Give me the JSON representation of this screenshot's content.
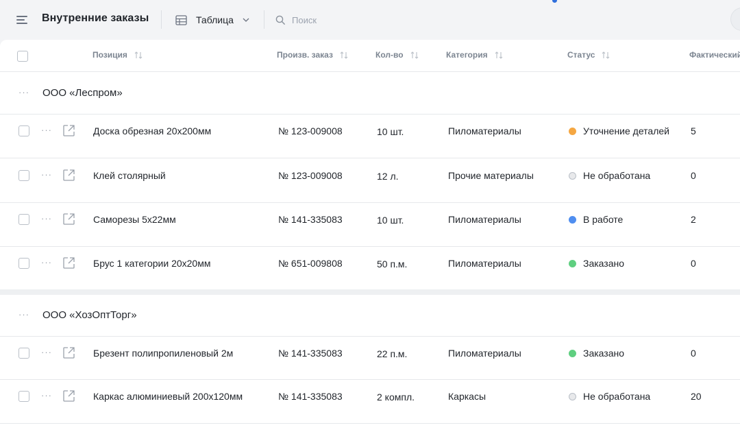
{
  "header": {
    "title": "Внутренние заказы",
    "view_label": "Таблица",
    "search_placeholder": "Поиск"
  },
  "columns": {
    "position": "Позиция",
    "order": "Произв. заказ",
    "qty": "Кол-во",
    "category": "Категория",
    "status": "Статус",
    "actual": "Фактический"
  },
  "groups": [
    {
      "name": "ООО «Леспром»",
      "rows": [
        {
          "position": "Доска обрезная 20х200мм",
          "order": "№ 123-009008",
          "qty": "10 шт.",
          "category": "Пиломатериалы",
          "status": "Уточнение деталей",
          "status_color": "#f5a742",
          "actual": "5"
        },
        {
          "position": "Клей столярный",
          "order": "№ 123-009008",
          "qty": "12 л.",
          "category": "Прочие материалы",
          "status": "Не обработана",
          "status_color": "#e8e9eb",
          "actual": "0"
        },
        {
          "position": "Саморезы 5х22мм",
          "order": "№ 141-335083",
          "qty": "10 шт.",
          "category": "Пиломатериалы",
          "status": "В работе",
          "status_color": "#4f8ef0",
          "actual": "2"
        },
        {
          "position": "Брус 1 категории 20х20мм",
          "order": "№ 651-009808",
          "qty": "50 п.м.",
          "category": "Пиломатериалы",
          "status": "Заказано",
          "status_color": "#5fcf80",
          "actual": "0"
        }
      ]
    },
    {
      "name": "ООО «ХозОптТорг»",
      "rows": [
        {
          "position": "Брезент полипропиленовый 2м",
          "order": "№ 141-335083",
          "qty": "22 п.м.",
          "category": "Пиломатериалы",
          "status": "Заказано",
          "status_color": "#5fcf80",
          "actual": "0"
        },
        {
          "position": "Каркас алюминиевый 200х120мм",
          "order": "№ 141-335083",
          "qty": "2 компл.",
          "category": "Каркасы",
          "status": "Не обработана",
          "status_color": "#e8e9eb",
          "actual": "20"
        }
      ]
    }
  ]
}
